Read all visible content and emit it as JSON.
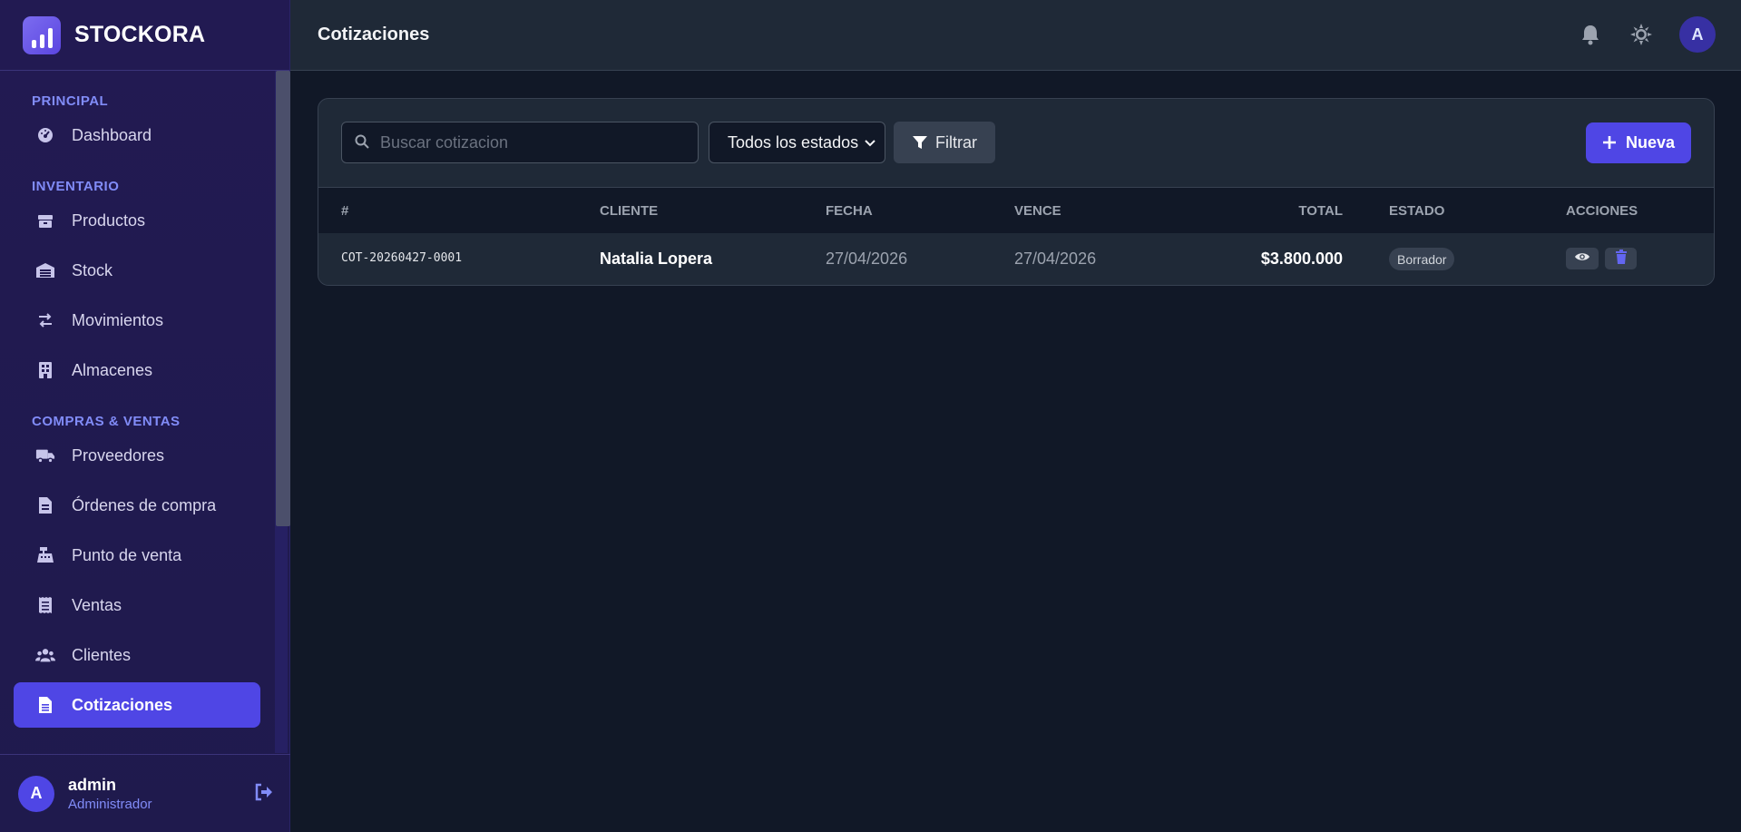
{
  "brand": {
    "name": "STOCKORA"
  },
  "sidebar": {
    "sections": [
      {
        "title": "PRINCIPAL"
      },
      {
        "title": "INVENTARIO"
      },
      {
        "title": "COMPRAS & VENTAS"
      }
    ],
    "items": [
      {
        "label": "Dashboard",
        "icon": "dashboard-icon"
      },
      {
        "label": "Productos",
        "icon": "box-icon"
      },
      {
        "label": "Stock",
        "icon": "warehouse-icon"
      },
      {
        "label": "Movimientos",
        "icon": "exchange-icon"
      },
      {
        "label": "Almacenes",
        "icon": "building-icon"
      },
      {
        "label": "Proveedores",
        "icon": "truck-icon"
      },
      {
        "label": "Órdenes de compra",
        "icon": "file-invoice-icon"
      },
      {
        "label": "Punto de venta",
        "icon": "cash-register-icon"
      },
      {
        "label": "Ventas",
        "icon": "receipt-icon"
      },
      {
        "label": "Clientes",
        "icon": "users-icon"
      },
      {
        "label": "Cotizaciones",
        "icon": "file-icon",
        "active": true
      }
    ],
    "user": {
      "initial": "A",
      "name": "admin",
      "role": "Administrador"
    }
  },
  "header": {
    "title": "Cotizaciones",
    "avatar_initial": "A"
  },
  "toolbar": {
    "search_placeholder": "Buscar cotizacion",
    "status_select": "Todos los estados",
    "filter_label": "Filtrar",
    "new_label": "Nueva"
  },
  "table": {
    "columns": [
      "#",
      "CLIENTE",
      "FECHA",
      "VENCE",
      "TOTAL",
      "ESTADO",
      "ACCIONES"
    ],
    "rows": [
      {
        "code": "COT-20260427-0001",
        "client": "Natalia Lopera",
        "date": "27/04/2026",
        "due": "27/04/2026",
        "total": "$3.800.000",
        "status": "Borrador"
      }
    ]
  },
  "colors": {
    "accent": "#4f46e5",
    "sidebar_bg": "#221a52",
    "page_bg": "#111827",
    "card_bg": "#1f2937"
  }
}
